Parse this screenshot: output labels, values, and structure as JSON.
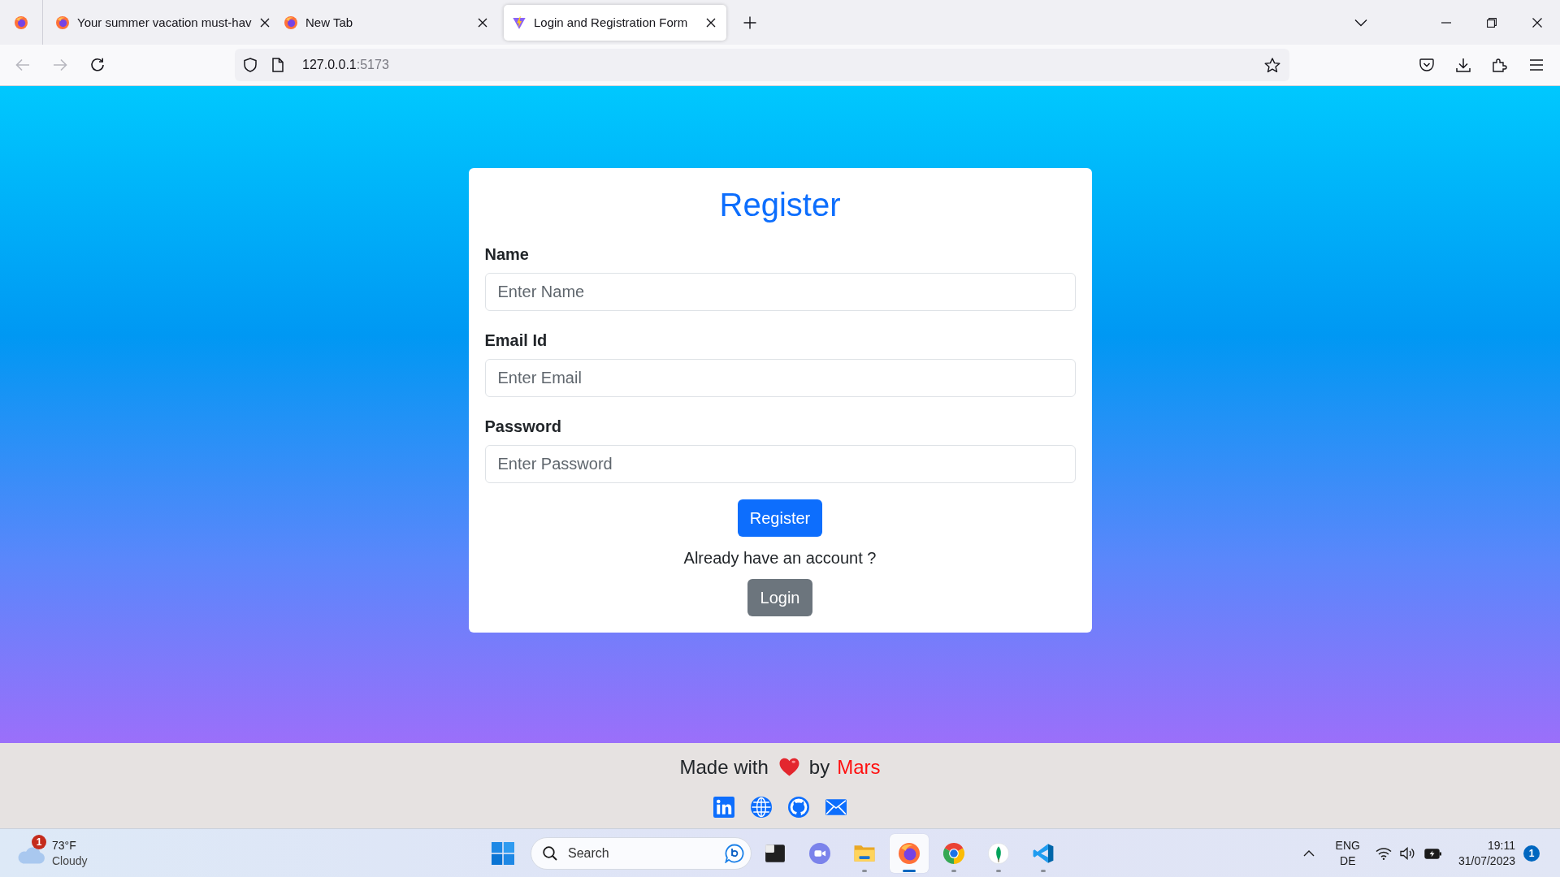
{
  "browser": {
    "tabs": [
      {
        "kind": "firefox",
        "title": "Your summer vacation must-hav",
        "selected": false
      },
      {
        "kind": "firefox",
        "title": "New Tab",
        "selected": false
      },
      {
        "kind": "vite",
        "title": "Login and Registration Form",
        "selected": true
      }
    ],
    "nav": {
      "back": {
        "disabled": true
      },
      "forward": {
        "disabled": true
      }
    },
    "url": {
      "host": "127.0.0.1",
      "port": ":5173"
    }
  },
  "form": {
    "title": "Register",
    "fields": [
      {
        "label": "Name",
        "placeholder": "Enter Name"
      },
      {
        "label": "Email Id",
        "placeholder": "Enter Email"
      },
      {
        "label": "Password",
        "placeholder": "Enter Password"
      }
    ],
    "submit_button": "Register",
    "prompt": "Already have an account ?",
    "login_button": "Login"
  },
  "footer": {
    "text_before": "Made with",
    "text_after": "by",
    "author": "Mars"
  },
  "taskbar": {
    "weather": {
      "badge": "1",
      "temperature": "73°F",
      "condition": "Cloudy"
    },
    "search": {
      "label": "Search"
    },
    "apps": [
      {
        "kind": "tile",
        "running": false,
        "selected": false
      },
      {
        "kind": "chat",
        "running": false,
        "selected": false
      },
      {
        "kind": "folder",
        "running": true,
        "selected": false
      },
      {
        "kind": "firefox",
        "running": true,
        "selected": true
      },
      {
        "kind": "chrome",
        "running": true,
        "selected": false
      },
      {
        "kind": "leaf",
        "running": true,
        "selected": false
      },
      {
        "kind": "code",
        "running": true,
        "selected": false
      }
    ],
    "language": {
      "primary": "ENG",
      "secondary": "DE"
    },
    "clock": {
      "time": "19:11",
      "date": "31/07/2023"
    },
    "notification_count": "1"
  }
}
